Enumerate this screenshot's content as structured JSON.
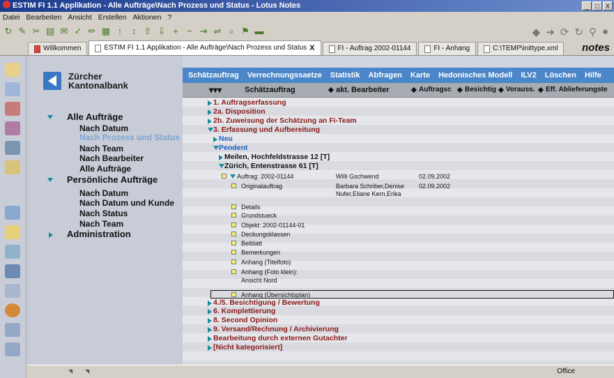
{
  "window": {
    "title": "ESTIM FI 1.1 Applikation - Alle Aufträge\\Nach Prozess und Status - Lotus Notes",
    "buttons": [
      "_",
      "□",
      "X"
    ]
  },
  "menu": [
    "Datei",
    "Bearbeiten",
    "Ansicht",
    "Erstellen",
    "Aktionen",
    "?"
  ],
  "tabs": [
    {
      "label": "Willkommen"
    },
    {
      "label": "ESTIM FI 1.1 Applikation - Alle Aufträge\\Nach Prozess und Status",
      "close": "X"
    },
    {
      "label": "FI - Auftrag 2002-01144"
    },
    {
      "label": "FI - Anhang"
    },
    {
      "label": "C:\\TEMP\\inittype.xml"
    }
  ],
  "brand": "notes",
  "bank": {
    "line1": "Zürcher",
    "line2": "Kantonalbank"
  },
  "nav": [
    {
      "label": "Alle Aufträge",
      "level": 0,
      "twisty": "down"
    },
    {
      "label": "Nach Datum",
      "level": 1
    },
    {
      "label": "Nach Prozess und Status",
      "level": 1,
      "selected": true
    },
    {
      "label": "Nach Team",
      "level": 1
    },
    {
      "label": "Nach Bearbeiter",
      "level": 1
    },
    {
      "label": "Alle Aufträge",
      "level": 1
    },
    {
      "label": "Persönliche Aufträge",
      "level": 0,
      "twisty": "down"
    },
    {
      "label": "Nach Datum",
      "level": 1
    },
    {
      "label": "Nach Datum und Kunde",
      "level": 1
    },
    {
      "label": "Nach Status",
      "level": 1
    },
    {
      "label": "Nach Team",
      "level": 1
    },
    {
      "label": "Administration",
      "level": 0,
      "twisty": "right"
    }
  ],
  "actions": [
    "Schätzauftrag",
    "Verrechnungssaetze",
    "Statistik",
    "Abfragen",
    "Karte",
    "Hedonisches Modell",
    "ILV2",
    "Löschen",
    "Hilfe"
  ],
  "columns": [
    "Schätzauftrag",
    "akt. Bearbeiter",
    "Auftragsc",
    "Besichtig",
    "Vorauss.",
    "Eff. Ablieferungste"
  ],
  "col_sort_glyph": "⬥",
  "rows": [
    {
      "text": "1. Auftragserfassung",
      "kind": "cat",
      "indent": 0,
      "twisty": "right"
    },
    {
      "text": "2a. Disposition",
      "kind": "cat",
      "indent": 0,
      "twisty": "right"
    },
    {
      "text": "2b. Zuweisung der Schätzung an Fi-Team",
      "kind": "cat",
      "indent": 0,
      "twisty": "right"
    },
    {
      "text": "3. Erfassung und Aufbereitung",
      "kind": "cat",
      "indent": 0,
      "twisty": "down"
    },
    {
      "text": "Neu",
      "kind": "blue",
      "indent": 1,
      "twisty": "right"
    },
    {
      "text": "Pendent",
      "kind": "blue",
      "indent": 1,
      "twisty": "down"
    },
    {
      "text": "Meilen, Hochfeldstrasse 12 [T]",
      "kind": "dark",
      "indent": 2,
      "twisty": "right"
    },
    {
      "text": "Zürich, Entenstrasse 61 [T]",
      "kind": "dark",
      "indent": 2,
      "twisty": "down"
    },
    {
      "text": "Auftrag: 2002-01144",
      "kind": "doc",
      "indent": 3,
      "twisty": "down",
      "bearbeiter": "Willi Gschwend",
      "datum": "02.09.2002"
    },
    {
      "text": "Originalauftrag",
      "kind": "doc",
      "indent": 4,
      "bearbeiter": "Barbara Schriber,Denise",
      "bearbeiter2": "Nufer,Eliane Kern,Erika",
      "datum": "02.09.2002"
    },
    {
      "text": "Details",
      "kind": "doc",
      "indent": 4,
      "icon": true
    },
    {
      "text": "Grundstueck",
      "kind": "doc",
      "indent": 4,
      "icon": true
    },
    {
      "text": "Objekt: 2002-01144-01",
      "kind": "doc",
      "indent": 4,
      "icon": true
    },
    {
      "text": "Deckungsklassen",
      "kind": "doc",
      "indent": 4,
      "icon": true
    },
    {
      "text": "Beiblatt",
      "kind": "doc",
      "indent": 4,
      "icon": true
    },
    {
      "text": "Bemerkungen",
      "kind": "doc",
      "indent": 4,
      "icon": true
    },
    {
      "text": "Anhang (Titelfoto)",
      "kind": "doc",
      "indent": 4,
      "icon": true
    },
    {
      "text": "Anhang (Foto klein):",
      "text2": "Ansicht Nord",
      "kind": "doc",
      "indent": 4,
      "icon": true
    },
    {
      "text": "Anhang (Übersichtsplan)",
      "kind": "doc",
      "indent": 4,
      "icon": true,
      "selected": true
    },
    {
      "text": "4./5. Besichtigung / Bewertung",
      "kind": "cat",
      "indent": 0,
      "twisty": "right"
    },
    {
      "text": "6. Komplettierung",
      "kind": "cat",
      "indent": 0,
      "twisty": "right"
    },
    {
      "text": "8. Second Opinion",
      "kind": "cat",
      "indent": 0,
      "twisty": "right"
    },
    {
      "text": "9. Versand/Rechnung / Archivierung",
      "kind": "cat",
      "indent": 0,
      "twisty": "right"
    },
    {
      "text": "Bearbeitung durch externen Gutachter",
      "kind": "cat",
      "indent": 0,
      "twisty": "right"
    },
    {
      "text": "[Nicht kategorisiert]",
      "kind": "cat",
      "indent": 0,
      "twisty": "right"
    }
  ],
  "status": {
    "location": "Office"
  },
  "colors": {
    "accent": "#4a86c8",
    "category": "#8b1a1a",
    "subcategory": "#1a5ec8",
    "twisty": "#1a8a9a"
  }
}
